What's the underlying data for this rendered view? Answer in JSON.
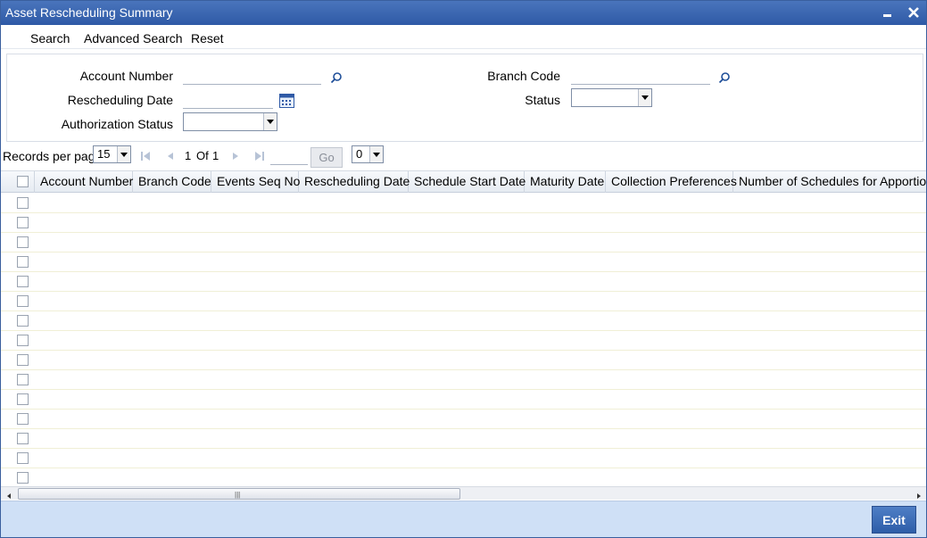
{
  "window": {
    "title": "Asset Rescheduling Summary"
  },
  "menu": {
    "search": "Search",
    "advanced_search": "Advanced Search",
    "reset": "Reset"
  },
  "criteria": {
    "account_number_label": "Account Number",
    "account_number_value": "",
    "branch_code_label": "Branch Code",
    "branch_code_value": "",
    "rescheduling_date_label": "Rescheduling Date",
    "rescheduling_date_value": "",
    "status_label": "Status",
    "status_value": "",
    "authorization_status_label": "Authorization Status",
    "authorization_status_value": ""
  },
  "pager": {
    "records_label": "Records per page",
    "records_per_page": "15",
    "current_page": "1",
    "of_label": "Of",
    "total_pages": "1",
    "go_label": "Go",
    "page_jump_value": "",
    "secondary_select": "0"
  },
  "grid": {
    "columns": [
      "Account Number",
      "Branch Code",
      "Events Seq No",
      "Rescheduling Date",
      "Schedule Start Date",
      "Maturity Date",
      "Collection Preferences",
      "Number of Schedules for Apportioning"
    ],
    "row_count": 15
  },
  "footer": {
    "exit_label": "Exit"
  },
  "colors": {
    "titlebar": "#3b66b1",
    "footer": "#cfe0f6",
    "exit_button": "#3a6ab5"
  }
}
